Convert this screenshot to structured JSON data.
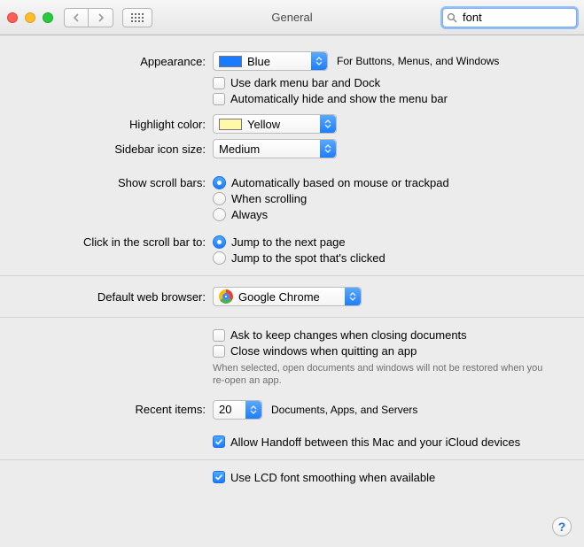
{
  "window": {
    "title": "General"
  },
  "search": {
    "value": "font"
  },
  "appearance": {
    "label": "Appearance:",
    "value": "Blue",
    "swatch_color": "#1a7bff",
    "hint": "For Buttons, Menus, and Windows",
    "dark_menu_label": "Use dark menu bar and Dock",
    "dark_menu_checked": false,
    "auto_hide_label": "Automatically hide and show the menu bar",
    "auto_hide_checked": false
  },
  "highlight": {
    "label": "Highlight color:",
    "value": "Yellow",
    "swatch_color": "#fff8a8"
  },
  "sidebar": {
    "label": "Sidebar icon size:",
    "value": "Medium"
  },
  "scrollbars": {
    "label": "Show scroll bars:",
    "options": [
      "Automatically based on mouse or trackpad",
      "When scrolling",
      "Always"
    ],
    "selected": 0
  },
  "clickbar": {
    "label": "Click in the scroll bar to:",
    "options": [
      "Jump to the next page",
      "Jump to the spot that's clicked"
    ],
    "selected": 0
  },
  "browser": {
    "label": "Default web browser:",
    "value": "Google Chrome"
  },
  "closing": {
    "ask_label": "Ask to keep changes when closing documents",
    "ask_checked": false,
    "close_windows_label": "Close windows when quitting an app",
    "close_windows_checked": false,
    "note": "When selected, open documents and windows will not be restored when you re-open an app."
  },
  "recent": {
    "label": "Recent items:",
    "value": "20",
    "hint": "Documents, Apps, and Servers"
  },
  "handoff": {
    "label": "Allow Handoff between this Mac and your iCloud devices",
    "checked": true
  },
  "lcd": {
    "label": "Use LCD font smoothing when available",
    "checked": true
  }
}
